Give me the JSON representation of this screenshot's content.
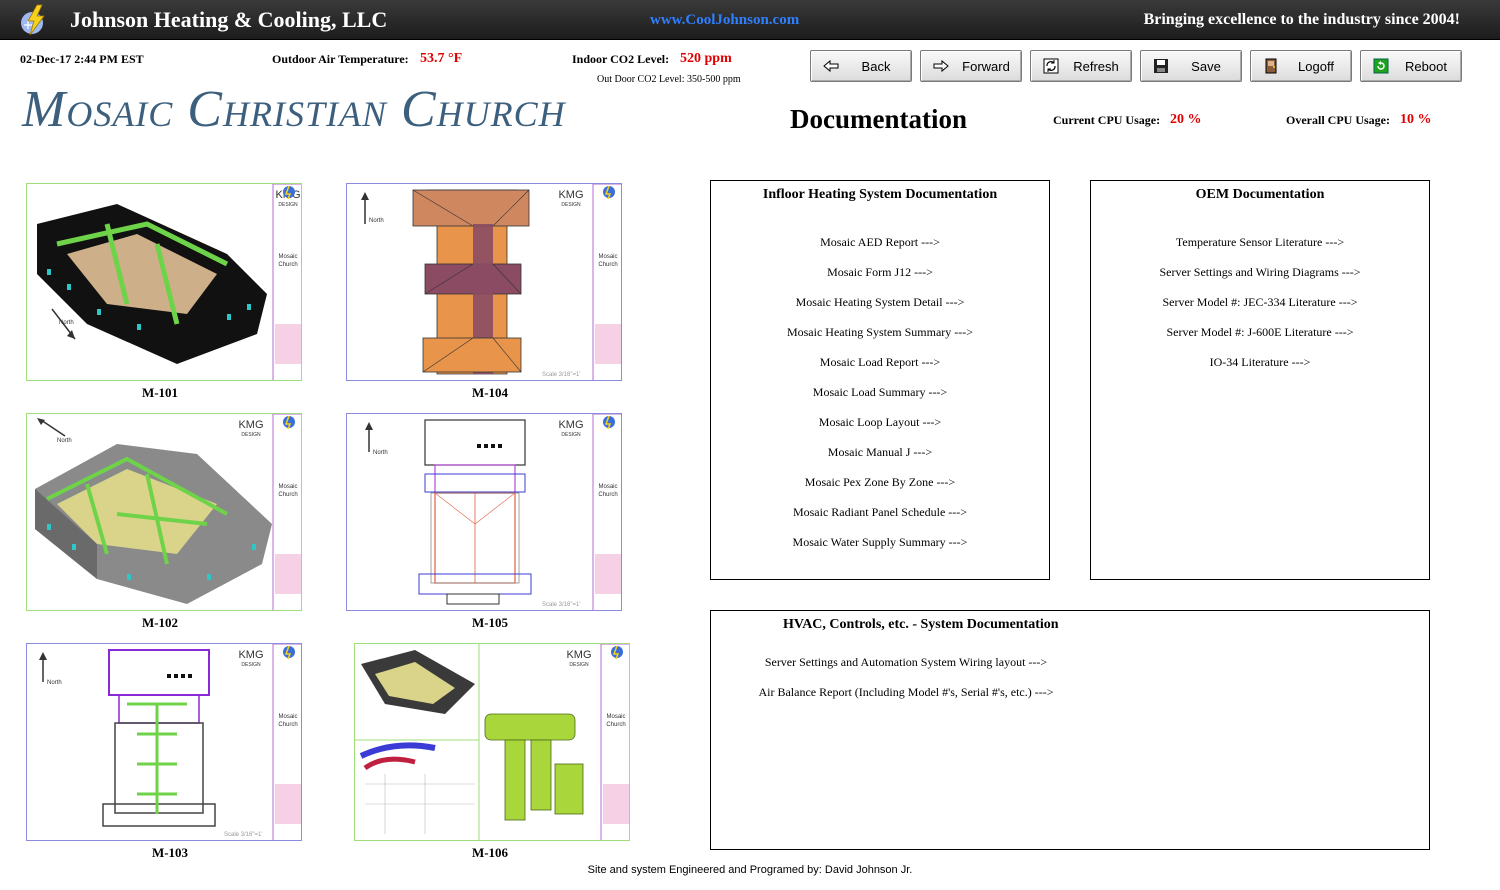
{
  "banner": {
    "company": "Johnson Heating & Cooling, LLC",
    "url": "www.CoolJohnson.com",
    "tagline": "Bringing excellence to the industry since 2004!",
    "logo_icon": "lightning-snowflake-icon"
  },
  "status": {
    "datetime": "02-Dec-17 2:44 PM EST",
    "outdoor_temp_label": "Outdoor Air Temperature:",
    "outdoor_temp_value": "53.7 °F",
    "indoor_co2_label": "Indoor CO2 Level:",
    "indoor_co2_value": "520 ppm",
    "outdoor_co2_note": "Out Door CO2 Level: 350-500 ppm",
    "cpu_current_label": "Current CPU Usage:",
    "cpu_current_value": "20 %",
    "cpu_overall_label": "Overall CPU Usage:",
    "cpu_overall_value": "10 %"
  },
  "toolbar": {
    "back": "Back",
    "forward": "Forward",
    "refresh": "Refresh",
    "save": "Save",
    "logoff": "Logoff",
    "reboot": "Reboot"
  },
  "page": {
    "church_title": "Mosaic Christian Church",
    "section_title": "Documentation"
  },
  "drawings": {
    "m101": "M-101",
    "m102": "M-102",
    "m103": "M-103",
    "m104": "M-104",
    "m105": "M-105",
    "m106": "M-106",
    "title_block": {
      "firm_line1": "KMG",
      "firm_line2": "DESIGN",
      "project_line1": "Mosaic",
      "project_line2": "Church",
      "north": "North",
      "scale": "Scale 3/16\"=1'"
    }
  },
  "infloor": {
    "title": "Infloor Heating System Documentation",
    "items": [
      "Mosaic AED Report --->",
      "Mosaic Form J12 --->",
      "Mosaic Heating System Detail --->",
      "Mosaic Heating System Summary --->",
      "Mosaic Load Report --->",
      "Mosaic Load Summary --->",
      "Mosaic Loop Layout --->",
      "Mosaic Manual J --->",
      "Mosaic Pex Zone By Zone --->",
      "Mosaic Radiant Panel Schedule --->",
      "Mosaic Water Supply Summary --->"
    ]
  },
  "oem": {
    "title": "OEM Documentation",
    "items": [
      "Temperature Sensor Literature --->",
      "Server Settings and Wiring Diagrams --->",
      "Server Model #: JEC-334 Literature --->",
      "Server Model #: J-600E Literature --->",
      "IO-34 Literature --->"
    ]
  },
  "hvac": {
    "title": "HVAC, Controls, etc. - System Documentation",
    "items": [
      "Server Settings and Automation System Wiring layout --->",
      "Air Balance Report (Including Model #'s, Serial #'s, etc.) --->"
    ]
  },
  "footer": "Site and system Engineered and Programed by: David Johnson Jr."
}
